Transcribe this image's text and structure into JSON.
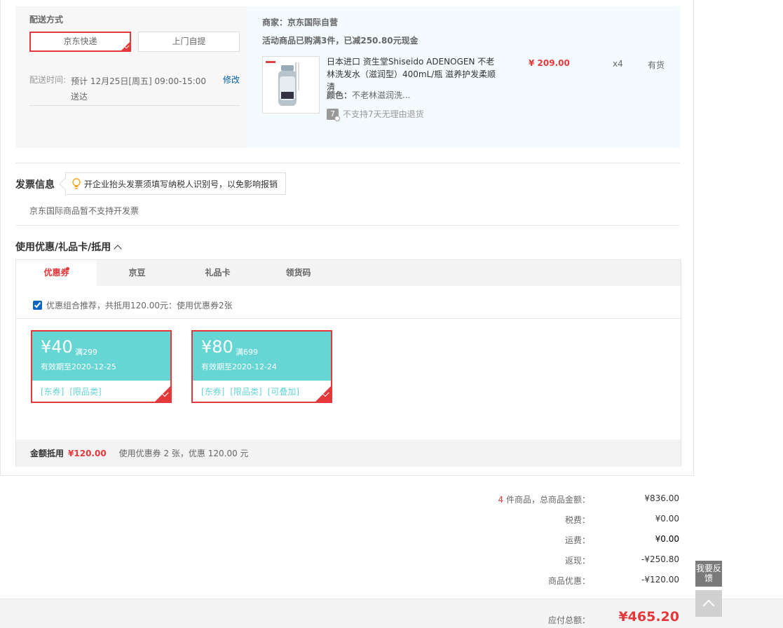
{
  "shipping": {
    "title": "配送方式",
    "options": [
      "京东快递",
      "上门自提"
    ],
    "selected": "京东快递",
    "time_label": "配送时间:",
    "time_value": "预计 12月25日[周五] 09:00-15:00 送达",
    "modify_label": "修改"
  },
  "order": {
    "merchant": "商家：京东国际自营",
    "promo": "活动商品已购满3件，已减250.80元现金",
    "product": {
      "name": "日本进口 资生堂Shiseido ADENOGEN 不老林洗发水（滋润型）400mL/瓶 滋养护发柔顺清",
      "color_label": "颜色：",
      "color_value": "不老林滋润洗...",
      "return_badge": "7",
      "return_text": "不支持7天无理由退货",
      "price": "¥ 209.00",
      "quantity": "x4",
      "stock": "有货"
    }
  },
  "invoice": {
    "title": "发票信息",
    "tip": "开企业抬头发票须填写纳税人识别号，以免影响报销",
    "note": "京东国际商品暂不支持开发票"
  },
  "coupons": {
    "title": "使用优惠/礼品卡/抵用",
    "tabs": [
      "优惠券",
      "京豆",
      "礼品卡",
      "领货码"
    ],
    "active_tab": "优惠券",
    "combo_text": "优惠组合推荐，共抵用120.00元：使用优惠券2张",
    "combo_checked": true,
    "items": [
      {
        "amount": "¥40",
        "condition": "满299",
        "expiry": "有效期至2020-12-25",
        "tags": [
          "[东券]",
          "[限品类]"
        ],
        "selected": true
      },
      {
        "amount": "¥80",
        "condition": "满699",
        "expiry": "有效期至2020-12-24",
        "tags": [
          "[东券]",
          "[限品类]",
          "[可叠加]"
        ],
        "selected": true
      }
    ],
    "deduct_label": "金额抵用",
    "deduct_amount": "¥120.00",
    "deduct_note": "使用优惠券 2 张，优惠 120.00 元"
  },
  "summary": {
    "count": "4",
    "count_label": "件商品，总商品金额：",
    "total_goods": "¥836.00",
    "tax_label": "税费：",
    "tax": "¥0.00",
    "freight_label": "运费：",
    "freight": "¥0.00",
    "rebate_label": "返现：",
    "rebate": "-¥250.80",
    "discount_label": "商品优惠：",
    "discount": "-¥120.00",
    "payable_label": "应付总额：",
    "payable": "¥465.20"
  },
  "side": {
    "feedback_label": "我要反馈"
  },
  "colors": {
    "accent": "#e4393c",
    "coupon": "#66d6d4",
    "link": "#005ea7"
  }
}
